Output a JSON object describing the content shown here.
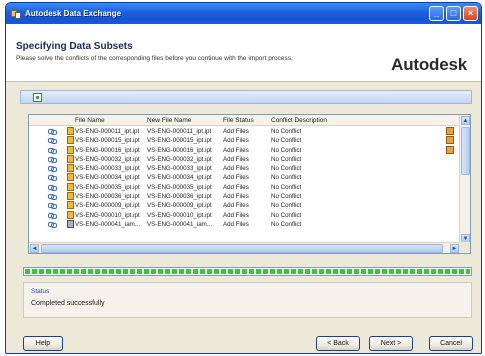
{
  "window": {
    "title": "Autodesk Data Exchange"
  },
  "title_buttons": {
    "minimize": "_",
    "maximize": "□",
    "close": "×"
  },
  "header": {
    "title": "Specifying Data Subsets",
    "subtitle": "Please solve the conflicts of the corresponding files before you continue with the import process.",
    "brand": "Autodesk"
  },
  "table": {
    "columns": [
      "File Name",
      "New File Name",
      "File Status",
      "Conflict Description"
    ],
    "rows": [
      {
        "file": "VS-ENG-000011_ipt.ipt",
        "new_file": "VS-ENG-000011_ipt.ipt",
        "status": "Add Files",
        "conflict": "No Conflict"
      },
      {
        "file": "VS-ENG-000015_ipt.ipt",
        "new_file": "VS-ENG-000015_ipt.ipt",
        "status": "Add Files",
        "conflict": "No Conflict"
      },
      {
        "file": "VS-ENG-000016_ipt.ipt",
        "new_file": "VS-ENG-000016_ipt.ipt",
        "status": "Add Files",
        "conflict": "No Conflict"
      },
      {
        "file": "VS-ENG-000032_ipt.ipt",
        "new_file": "VS-ENG-000032_ipt.ipt",
        "status": "Add Files",
        "conflict": "No Conflict"
      },
      {
        "file": "VS-ENG-000033_ipt.ipt",
        "new_file": "VS-ENG-000033_ipt.ipt",
        "status": "Add Files",
        "conflict": "No Conflict"
      },
      {
        "file": "VS-ENG-000034_ipt.ipt",
        "new_file": "VS-ENG-000034_ipt.ipt",
        "status": "Add Files",
        "conflict": "No Conflict"
      },
      {
        "file": "VS-ENG-000035_ipt.ipt",
        "new_file": "VS-ENG-000035_ipt.ipt",
        "status": "Add Files",
        "conflict": "No Conflict"
      },
      {
        "file": "VS-ENG-000036_ipt.ipt",
        "new_file": "VS-ENG-000036_ipt.ipt",
        "status": "Add Files",
        "conflict": "No Conflict"
      },
      {
        "file": "VS-ENG-000009_ipt.ipt",
        "new_file": "VS-ENG-000009_ipt.ipt",
        "status": "Add Files",
        "conflict": "No Conflict"
      },
      {
        "file": "VS-ENG-000010_ipt.ipt",
        "new_file": "VS-ENG-000010_ipt.ipt",
        "status": "Add Files",
        "conflict": "No Conflict"
      },
      {
        "file": "VS-ENG-000041_iam...",
        "new_file": "VS-ENG-000041_iam...",
        "status": "Add Files",
        "conflict": "No Conflict"
      }
    ],
    "scroll_up": "▲",
    "scroll_down": "▼",
    "scroll_left": "◄",
    "scroll_right": "►"
  },
  "progress": {
    "percent": 100
  },
  "status": {
    "label": "Status",
    "text": "Completed successfully"
  },
  "buttons": {
    "help": "Help",
    "back": "< Back",
    "next": "Next >",
    "cancel": "Cancel"
  },
  "colors": {
    "titlebar": "#1b5fdc",
    "progress": "#3cc43c",
    "accent": "#1b4db8"
  },
  "icons": [
    "app-icon",
    "toolbar-icon",
    "link-icon",
    "file-icon",
    "assembly-file-icon",
    "status-column-icon"
  ]
}
